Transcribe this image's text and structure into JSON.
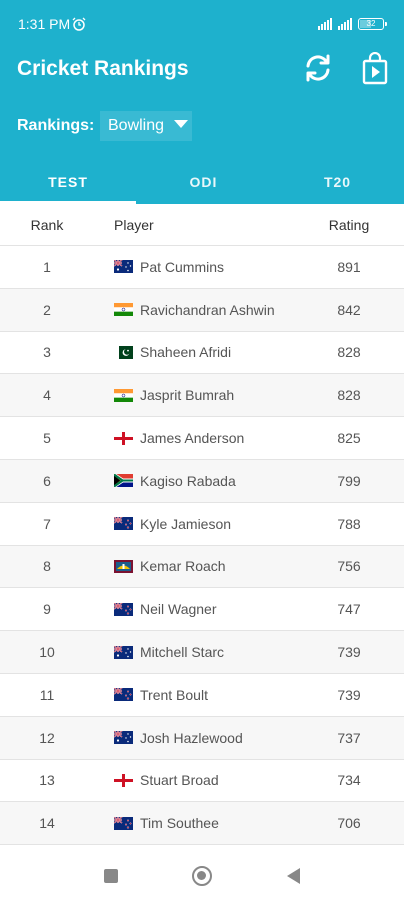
{
  "status_bar": {
    "time": "1:31 PM",
    "battery": "32"
  },
  "app": {
    "title": "Cricket Rankings",
    "refresh_icon": "refresh-icon",
    "store_icon": "play-store-icon",
    "accent_color": "#1eb1cd"
  },
  "filter": {
    "label": "Rankings:",
    "selected": "Bowling"
  },
  "tabs": [
    {
      "label": "TEST",
      "active": true
    },
    {
      "label": "ODI",
      "active": false
    },
    {
      "label": "T20",
      "active": false
    }
  ],
  "table": {
    "columns": {
      "rank": "Rank",
      "player": "Player",
      "rating": "Rating"
    },
    "rows": [
      {
        "rank": "1",
        "player": "Pat Cummins",
        "country": "australia",
        "rating": "891"
      },
      {
        "rank": "2",
        "player": "Ravichandran Ashwin",
        "country": "india",
        "rating": "842"
      },
      {
        "rank": "3",
        "player": "Shaheen Afridi",
        "country": "pakistan",
        "rating": "828"
      },
      {
        "rank": "4",
        "player": "Jasprit Bumrah",
        "country": "india",
        "rating": "828"
      },
      {
        "rank": "5",
        "player": "James Anderson",
        "country": "england",
        "rating": "825"
      },
      {
        "rank": "6",
        "player": "Kagiso Rabada",
        "country": "south-africa",
        "rating": "799"
      },
      {
        "rank": "7",
        "player": "Kyle Jamieson",
        "country": "new-zealand",
        "rating": "788"
      },
      {
        "rank": "8",
        "player": "Kemar Roach",
        "country": "west-indies",
        "rating": "756"
      },
      {
        "rank": "9",
        "player": "Neil Wagner",
        "country": "new-zealand",
        "rating": "747"
      },
      {
        "rank": "10",
        "player": "Mitchell Starc",
        "country": "australia",
        "rating": "739"
      },
      {
        "rank": "11",
        "player": "Trent Boult",
        "country": "new-zealand",
        "rating": "739"
      },
      {
        "rank": "12",
        "player": "Josh Hazlewood",
        "country": "australia",
        "rating": "737"
      },
      {
        "rank": "13",
        "player": "Stuart Broad",
        "country": "england",
        "rating": "734"
      },
      {
        "rank": "14",
        "player": "Tim Southee",
        "country": "new-zealand",
        "rating": "706"
      }
    ]
  },
  "nav": {
    "recents_icon": "recents-icon",
    "home_icon": "home-icon",
    "back_icon": "back-icon"
  }
}
